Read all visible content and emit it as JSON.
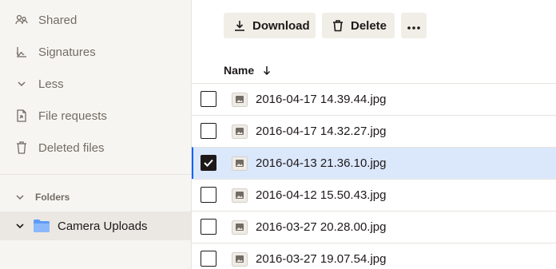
{
  "sidebar": {
    "items": [
      {
        "label": "Shared",
        "icon": "shared-icon"
      },
      {
        "label": "Signatures",
        "icon": "signature-icon"
      },
      {
        "label": "Less",
        "icon": "chevron-down-icon"
      },
      {
        "label": "File requests",
        "icon": "file-request-icon"
      },
      {
        "label": "Deleted files",
        "icon": "trash-icon"
      }
    ],
    "folders_header": "Folders",
    "folder": {
      "label": "Camera Uploads",
      "icon": "folder-icon"
    }
  },
  "toolbar": {
    "download_label": "Download",
    "delete_label": "Delete",
    "more_icon": "more-horizontal-icon"
  },
  "list": {
    "column_name": "Name",
    "sort_icon": "arrow-down-icon",
    "rows": [
      {
        "name": "2016-04-17 14.39.44.jpg",
        "selected": false
      },
      {
        "name": "2016-04-17 14.32.27.jpg",
        "selected": false
      },
      {
        "name": "2016-04-13 21.36.10.jpg",
        "selected": true
      },
      {
        "name": "2016-04-12 15.50.43.jpg",
        "selected": false
      },
      {
        "name": "2016-03-27 20.28.00.jpg",
        "selected": false
      },
      {
        "name": "2016-03-27 19.07.54.jpg",
        "selected": false
      }
    ]
  },
  "colors": {
    "sidebar_bg": "#f7f5f2",
    "selected_row_bg": "#dbe8fc",
    "accent": "#0061fe",
    "folder_blue": "#5e9cf7"
  }
}
